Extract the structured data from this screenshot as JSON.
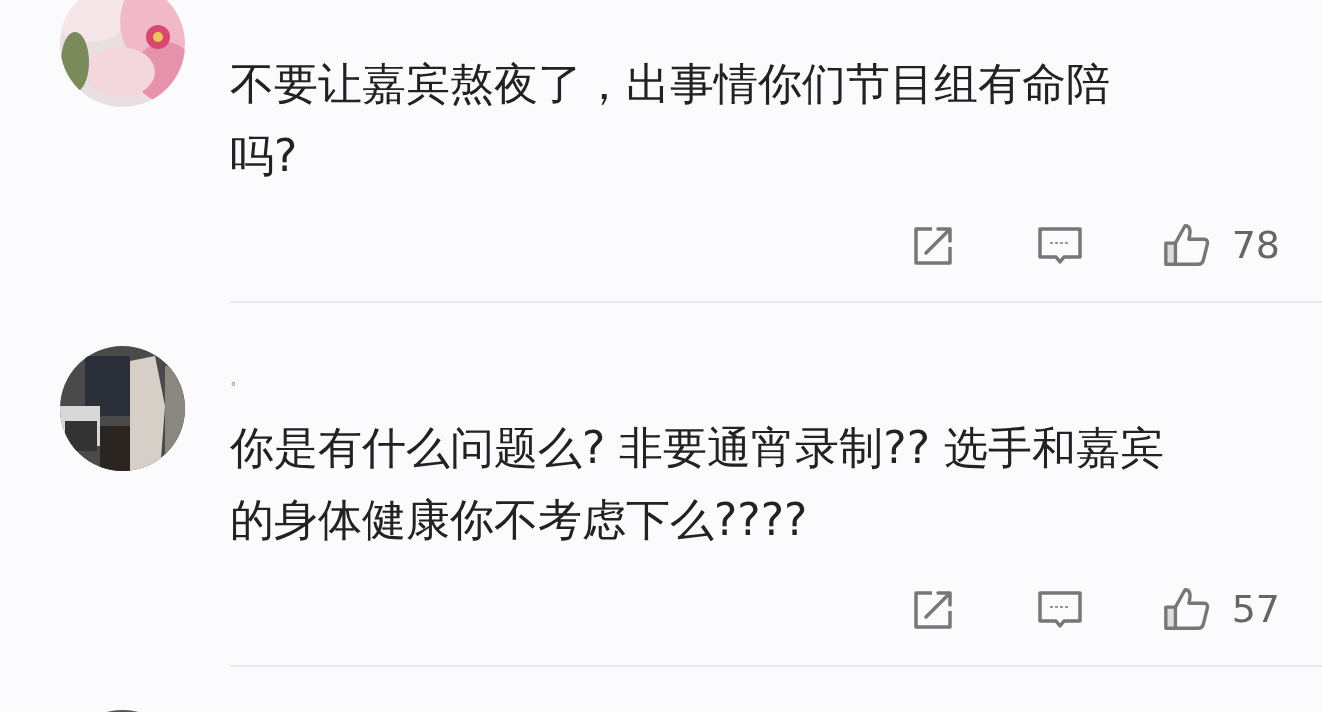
{
  "comments": [
    {
      "avatar": {
        "kind": "picture"
      },
      "text_lines": [
        "不要让嘉宾熬夜了，出事情你们节目组有命陪",
        "吗?"
      ],
      "likes": "78"
    },
    {
      "avatar": {
        "kind": "picture"
      },
      "username": "。",
      "text_lines": [
        "你是有什么问题么? 非要通宵录制?? 选手和嘉宾",
        "的身体健康你不考虑下么????"
      ],
      "likes": "57"
    },
    {
      "avatar": {
        "kind": "picture"
      }
    }
  ]
}
